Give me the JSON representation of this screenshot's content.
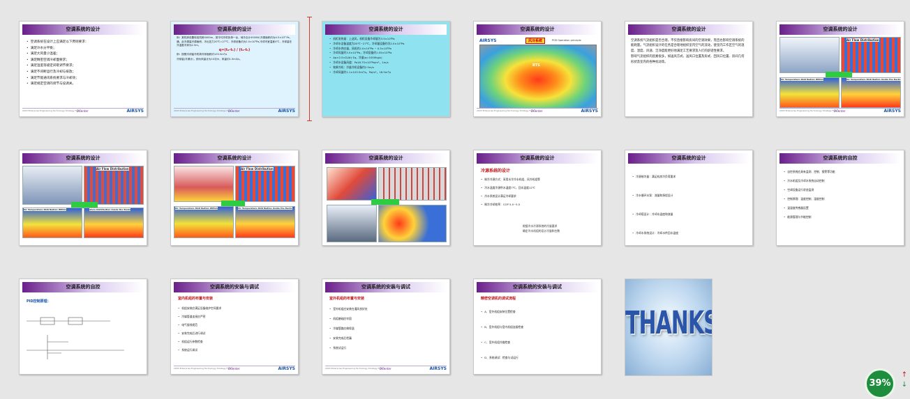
{
  "slide_title": "空调系统的设计",
  "footer": {
    "left": "2003 Enterprise Engineering Technology Strategy Forum",
    "center": "DCenter",
    "right": "AIRSYS"
  },
  "zoom": "39%",
  "colors": {
    "title_bar": "#6a1f8a",
    "selected": "#8fe3f0",
    "accent_red": "#c0151c",
    "badge": "#1e8e3e"
  },
  "slides": {
    "s1": {
      "title": "空调系统的设计",
      "items": [
        "空调系统在设计上应满足以下原则要求：",
        "满足冷水分平衡；",
        "满足大风量小温差；",
        "满足精密空调冷却面要求；",
        "满足温度等级定间歇调节要求；",
        "满足不间断运行及冷却与排放；",
        "满足节能通讯系统要求与冷却效；",
        "满足规定空调的调节与设调关。"
      ]
    },
    "s2": {
      "title": "空调系统的设计",
      "p1": "例：某机房设置电信机房4000m，按平均冷机负荷一台，地冷合计4500W,冷源面积约为4.5×10³ Pa，通，此冷源量冷源面积，冷出压力20℃=27℃，冷却设备约为2.0×10³Pa,冷却冷室温差4℃，冷却量在冷温差冷却为2.5m。",
      "formula": "q=(t₂-t₁) / (t₂-t₁)",
      "p2": "例：按照冷却量冷机荷冷却面积约103.5m³/s",
      "p3": "冷却量(冷源计)，即为风量计为10次/h，风量约1.5m3/s。"
    },
    "s3": {
      "title": "空调系统的设计",
      "items": [
        "机柜发热量：上送风，机柜设备冷却量为3.5×10³Pa",
        "冷却水设备温度为20℃~27℃，冷却量设备约为2.0×10³Pa",
        "冷却水供应量，风机约2.0×10³Pa ~ 0.5×10³Pa",
        "冷却风量约3.5×10³Pa，冷却设备约1.05×10³Pa",
        "Δp≈2.5×Σ(Δt)·Σq，冷量(q=1000kg/s)",
        "冷却水设备风道：Pa18.75×10³Pa/m²，1m/s",
        "效果冷机：冷量冷机设备约2.5m/s",
        "冷却风量约1.1×103.5m³/s，Pa/m²，18.5m³/s"
      ]
    },
    "s4": {
      "title": "空调系统的设计",
      "brand": "AIRSYS",
      "label": "风冷系统",
      "sub": "PCB Operation principle",
      "bts": "BTS"
    },
    "s5": {
      "title": "空调系统的设计",
      "p1": "空调系统气流组织是否合理，不仅直接影响房间的空调效果，而且也影响空调系统的能耗量。气流组织设计的任务是合理地组织室内空气的流动，使室内工作区空气的温度、湿度、风速、洁净度能更好地满足工艺要求及人们的舒适性要求。",
      "p2": "影响气流组织的因素很多，如送风方式、送风口位置及形式、回风口位置、房间几何形状及室内的各种扰动等。"
    },
    "s6": {
      "title": "空调系统的设计",
      "c1": "Air Flow Distribution",
      "c2": "Air Temperature Distribution Within",
      "c3": "Air Temperature Distribution Inside the Racks"
    },
    "s7": {
      "title": "空调系统的设计",
      "c1": "Air Flow Distribution",
      "c2": "Air Temperature Distribution Within",
      "c3": "ature Distribution Inside the Racks"
    },
    "s8": {
      "title": "空调系统的设计",
      "c1": "Air Flow Distribution",
      "c2": "Air Temperature Distribution Within",
      "c3": "Air Temperature Distribution Inside the Racks"
    },
    "s9": {
      "title": "空调系统的设计"
    },
    "s10": {
      "title": "空调系统的设计",
      "head": "冷源系统的设计",
      "items": [
        "制冷冷源方式：采用水冷冷水机组、风冷机组等",
        "冷水温度冷源供水温度7℃，回水温度12℃",
        "冷水系统设计满足冷却要求",
        "制冷冷却效率：COP 5.0~5.5"
      ],
      "note1": "根据冷水冷源系统的冷量要求",
      "note2": "确定冷水机组的设计冷量和台数"
    },
    "s11": {
      "title": "空调系统的设计",
      "items": [
        "冷源制冷量：满足机房冷负荷要求",
        "冷水循环水泵：流量和扬程设计",
        "冷却塔设计：冷却水温度和流量",
        "冷却水系统设计：冷却水供回水温度"
      ]
    },
    "s12": {
      "title": "空调系统的自控",
      "items": [
        "自控系统应具有监测、控制、报警等功能",
        "冷水机组及冷却水系统自动控制",
        "空调设备运行状态监测",
        "控制原理：温度控制、湿度控制",
        "温湿度传感器设置",
        "能源管理与节能控制"
      ]
    },
    "s13": {
      "title": "空调系统的自控",
      "head": "PID控制原理："
    },
    "s14": {
      "title": "空调系统的安装与调试",
      "head": "室内机组的布置与安装",
      "items": [
        "机组安装应满足设备维护空间要求",
        "冷媒管道连接应严密",
        "电气接线规范",
        "安装完成后进行调试",
        "机组运行参数检查",
        "系统运行调试"
      ]
    },
    "s15": {
      "title": "空调系统的安装与调试",
      "head": "室外机组的布置与安装",
      "items": [
        "室外机组应安装在通风良好处",
        "机组基础应牢固",
        "冷媒管路应做保温",
        "安装完成后检漏",
        "系统试运行"
      ]
    },
    "s16": {
      "title": "空调系统的安装与调试",
      "head": "精密空调机的调试流程",
      "items": [
        "A、室外机组安装位置检查",
        "B、室外机组与室内机组连接检查",
        "C、室外机组冷媒检查",
        "D、系统调试：检查与试运行"
      ]
    },
    "thanks": "THANKS"
  }
}
